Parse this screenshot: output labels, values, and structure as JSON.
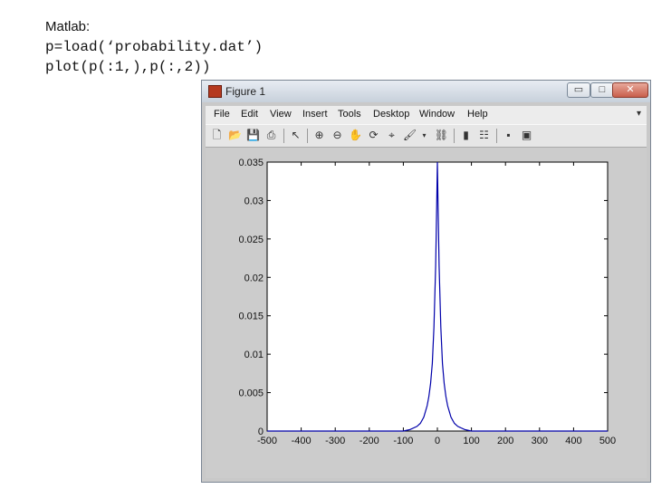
{
  "caption": {
    "heading": "Matlab:",
    "code_line_1": "p=load(‘probability.dat’)",
    "code_line_2": "plot(p(:1,),p(:,2))"
  },
  "window": {
    "title": "Figure 1",
    "buttons": {
      "minimize": "▭",
      "maximize": "□",
      "close": "✕"
    }
  },
  "menu": [
    "File",
    "Edit",
    "View",
    "Insert",
    "Tools",
    "Desktop",
    "Window",
    "Help"
  ],
  "toolbar": {
    "icons": [
      "new-figure-icon",
      "open-file-icon",
      "save-icon",
      "print-icon",
      "pointer-icon",
      "zoom-in-icon",
      "zoom-out-icon",
      "pan-icon",
      "rotate-3d-icon",
      "data-cursor-icon",
      "brush-icon",
      "link-plot-icon",
      "colorbar-icon",
      "legend-icon",
      "hide-plot-tools-icon",
      "show-plot-tools-icon"
    ]
  },
  "colors": {
    "line": "#0000aa",
    "axes_bg": "#ffffff",
    "figure_bg": "#cccccc"
  },
  "chart_data": {
    "type": "line",
    "title": "",
    "xlabel": "",
    "ylabel": "",
    "xlim": [
      -500,
      500
    ],
    "ylim": [
      0,
      0.035
    ],
    "xticks": [
      -500,
      -400,
      -300,
      -200,
      -100,
      0,
      100,
      200,
      300,
      400,
      500
    ],
    "yticks": [
      0,
      0.005,
      0.01,
      0.015,
      0.02,
      0.025,
      0.03,
      0.035
    ],
    "xtick_labels": [
      "-500",
      "-400",
      "-300",
      "-200",
      "-100",
      "0",
      "100",
      "200",
      "300",
      "400",
      "500"
    ],
    "ytick_labels": [
      "0",
      "0.005",
      "0.01",
      "0.015",
      "0.02",
      "0.025",
      "0.03",
      "0.035"
    ],
    "grid": false,
    "series": [
      {
        "x": [
          -500,
          -100,
          -80,
          -60,
          -50,
          -40,
          -30,
          -25,
          -20,
          -15,
          -10,
          -5,
          -2,
          0,
          2,
          5,
          10,
          15,
          20,
          25,
          30,
          40,
          50,
          60,
          80,
          100,
          500
        ],
        "y": [
          0,
          0,
          0.0002,
          0.0006,
          0.001,
          0.0018,
          0.0033,
          0.0045,
          0.0062,
          0.0088,
          0.0135,
          0.0215,
          0.029,
          0.035,
          0.029,
          0.0215,
          0.0135,
          0.0088,
          0.0062,
          0.0045,
          0.0033,
          0.0018,
          0.001,
          0.0006,
          0.0002,
          0,
          0
        ]
      }
    ]
  }
}
